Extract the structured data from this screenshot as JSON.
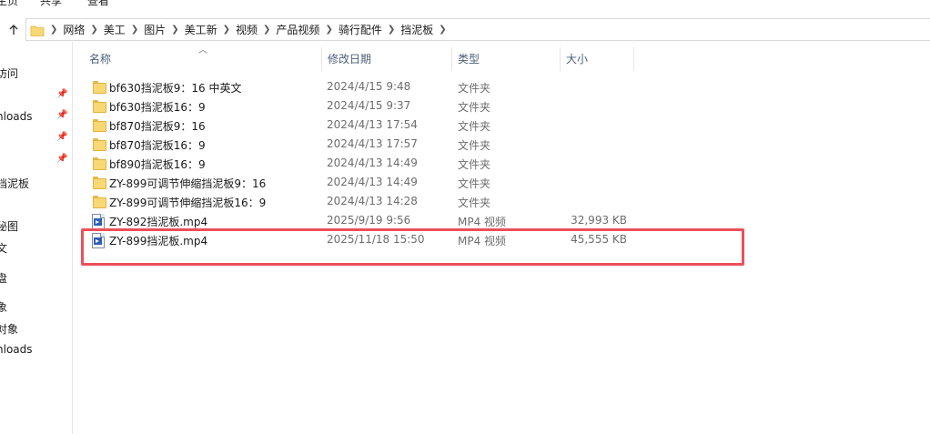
{
  "ribbon": {
    "tabs": [
      "主页",
      "共享",
      "查看"
    ]
  },
  "address_bar": {
    "up_icon": "up-arrow-icon",
    "crumbs": [
      "网络",
      "美工",
      "图片",
      "美工新",
      "视频",
      "产品视频",
      "骑行配件",
      "挡泥板"
    ]
  },
  "nav_pane": {
    "items": [
      "访问",
      "nloads",
      "挡泥板",
      "秘图",
      "文",
      "盘",
      "象",
      "对象",
      "nloads"
    ]
  },
  "columns": {
    "name": "名称",
    "date": "修改日期",
    "type": "类型",
    "size": "大小"
  },
  "files": [
    {
      "name": "bf630挡泥板9：16  中英文",
      "date": "2024/4/15 9:48",
      "type": "文件夹",
      "size": "",
      "icon": "folder-icon"
    },
    {
      "name": "bf630挡泥板16：9",
      "date": "2024/4/15 9:37",
      "type": "文件夹",
      "size": "",
      "icon": "folder-icon"
    },
    {
      "name": "bf870挡泥板9：16",
      "date": "2024/4/13 17:54",
      "type": "文件夹",
      "size": "",
      "icon": "folder-icon"
    },
    {
      "name": "bf870挡泥板16：9",
      "date": "2024/4/13 17:57",
      "type": "文件夹",
      "size": "",
      "icon": "folder-icon"
    },
    {
      "name": "bf890挡泥板16：9",
      "date": "2024/4/13 14:49",
      "type": "文件夹",
      "size": "",
      "icon": "folder-icon"
    },
    {
      "name": "ZY-899可调节伸缩挡泥板9：16",
      "date": "2024/4/13 14:49",
      "type": "文件夹",
      "size": "",
      "icon": "folder-icon"
    },
    {
      "name": "ZY-899可调节伸缩挡泥板16：9",
      "date": "2024/4/13 14:28",
      "type": "文件夹",
      "size": "",
      "icon": "folder-icon"
    },
    {
      "name": "ZY-892挡泥板.mp4",
      "date": "2025/9/19 9:56",
      "type": "MP4 视频",
      "size": "32,993 KB",
      "icon": "video-file-icon"
    },
    {
      "name": "ZY-899挡泥板.mp4",
      "date": "2025/11/18 15:50",
      "type": "MP4 视频",
      "size": "45,555 KB",
      "icon": "video-file-icon"
    }
  ],
  "colors": {
    "highlight": "#ec4f5a",
    "folder": "#f8d775",
    "header_text": "#4c607a"
  }
}
